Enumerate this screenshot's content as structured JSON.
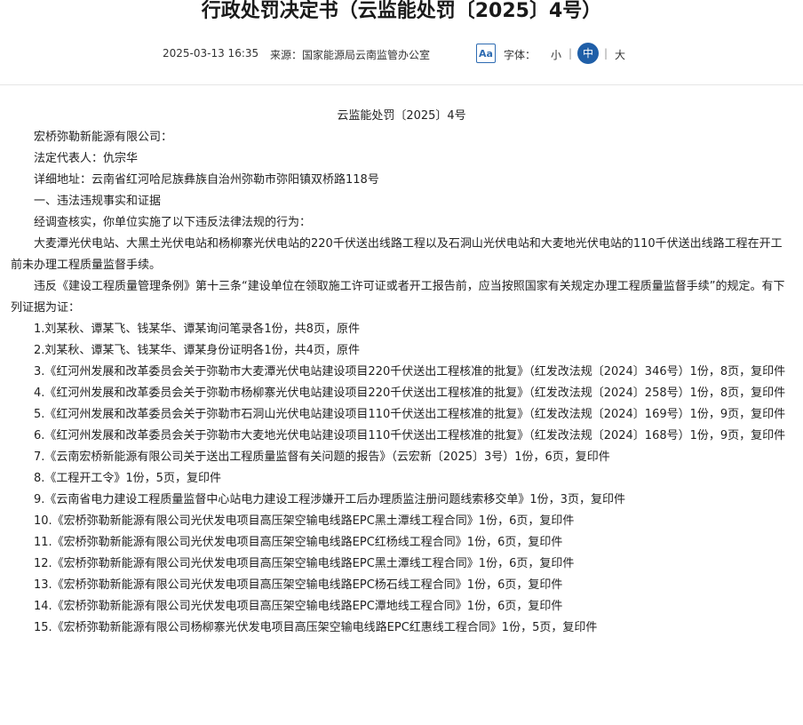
{
  "header": {
    "title": "行政处罚决定书（云监能处罚〔2025〕4号）",
    "date": "2025-03-13 16:35",
    "source": "来源：国家能源局云南监管办公室",
    "aa_label": "Aa",
    "font_label": "字体：",
    "font_small": "小",
    "font_medium": "中",
    "font_large": "大",
    "separator": "|"
  },
  "document": {
    "number": "云监能处罚〔2025〕4号",
    "paragraphs": [
      "宏桥弥勒新能源有限公司：",
      "法定代表人：仇宗华",
      "详细地址：云南省红河哈尼族彝族自治州弥勒市弥阳镇双桥路118号",
      "一、违法违规事实和证据",
      "经调查核实，你单位实施了以下违反法律法规的行为：",
      "大麦潭光伏电站、大黑土光伏电站和杨柳寨光伏电站的220千伏送出线路工程以及石洞山光伏电站和大麦地光伏电站的110千伏送出线路工程在开工前未办理工程质量监督手续。",
      "违反《建设工程质量管理条例》第十三条“建设单位在领取施工许可证或者开工报告前，应当按照国家有关规定办理工程质量监督手续”的规定。有下列证据为证：",
      "1.刘某秋、谭某飞、钱某华、谭某询问笔录各1份，共8页，原件",
      "2.刘某秋、谭某飞、钱某华、谭某身份证明各1份，共4页，原件",
      "3.《红河州发展和改革委员会关于弥勒市大麦潭光伏电站建设项目220千伏送出工程核准的批复》（红发改法规〔2024〕346号）1份，8页，复印件",
      "4.《红河州发展和改革委员会关于弥勒市杨柳寨光伏电站建设项目220千伏送出工程核准的批复》（红发改法规〔2024〕258号）1份，8页，复印件",
      "5.《红河州发展和改革委员会关于弥勒市石洞山光伏电站建设项目110千伏送出工程核准的批复》（红发改法规〔2024〕169号）1份，9页，复印件",
      "6.《红河州发展和改革委员会关于弥勒市大麦地光伏电站建设项目110千伏送出工程核准的批复》（红发改法规〔2024〕168号）1份，9页，复印件",
      "7.《云南宏桥新能源有限公司关于送出工程质量监督有关问题的报告》（云宏新〔2025〕3号）1份，6页，复印件",
      "8.《工程开工令》1份，5页，复印件",
      "9.《云南省电力建设工程质量监督中心站电力建设工程涉嫌开工后办理质监注册问题线索移交单》1份，3页，复印件",
      "10.《宏桥弥勒新能源有限公司光伏发电项目高压架空输电线路EPC黑土潭线工程合同》1份，6页，复印件",
      "11.《宏桥弥勒新能源有限公司光伏发电项目高压架空输电线路EPC红杨线工程合同》1份，6页，复印件",
      "12.《宏桥弥勒新能源有限公司光伏发电项目高压架空输电线路EPC黑土潭线工程合同》1份，6页，复印件",
      "13.《宏桥弥勒新能源有限公司光伏发电项目高压架空输电线路EPC杨石线工程合同》1份，6页，复印件",
      "14.《宏桥弥勒新能源有限公司光伏发电项目高压架空输电线路EPC潭地线工程合同》1份，6页，复印件",
      "15.《宏桥弥勒新能源有限公司杨柳寨光伏发电项目高压架空输电线路EPC红惠线工程合同》1份，5页，复印件"
    ]
  }
}
